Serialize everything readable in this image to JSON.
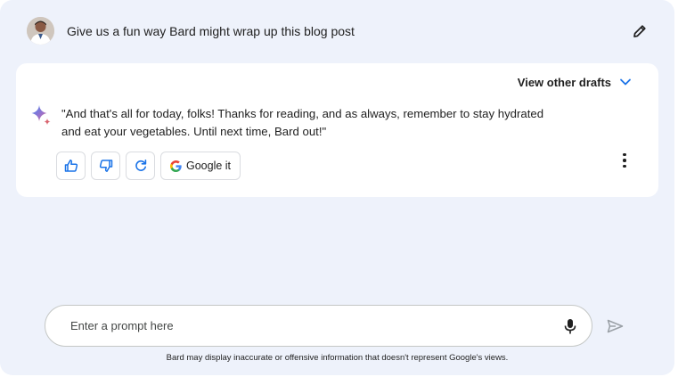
{
  "prompt": {
    "text": "Give us a fun way Bard might wrap up this blog post",
    "avatar_icon": "user-avatar",
    "edit_icon": "pencil-icon"
  },
  "response": {
    "view_drafts_label": "View other drafts",
    "drafts_icon": "chevron-down-icon",
    "bard_icon": "bard-sparkle-icon",
    "text": "\"And that's all for today, folks! Thanks for reading, and as always, remember to stay hydrated and eat your vegetables. Until next time, Bard out!\"",
    "actions": {
      "thumbs_up_icon": "thumbs-up-icon",
      "thumbs_down_icon": "thumbs-down-icon",
      "regenerate_icon": "refresh-icon",
      "google_it_label": "Google it",
      "more_icon": "more-vert-icon"
    }
  },
  "input": {
    "placeholder": "Enter a prompt here",
    "value": "",
    "mic_icon": "microphone-icon",
    "send_icon": "send-icon"
  },
  "disclaimer": "Bard may display inaccurate or offensive information that doesn't represent Google's views.",
  "colors": {
    "background": "#eef2fb",
    "card": "#ffffff",
    "accent_blue": "#1a73e8",
    "text": "#1f1f1f",
    "border": "#dadce0"
  }
}
